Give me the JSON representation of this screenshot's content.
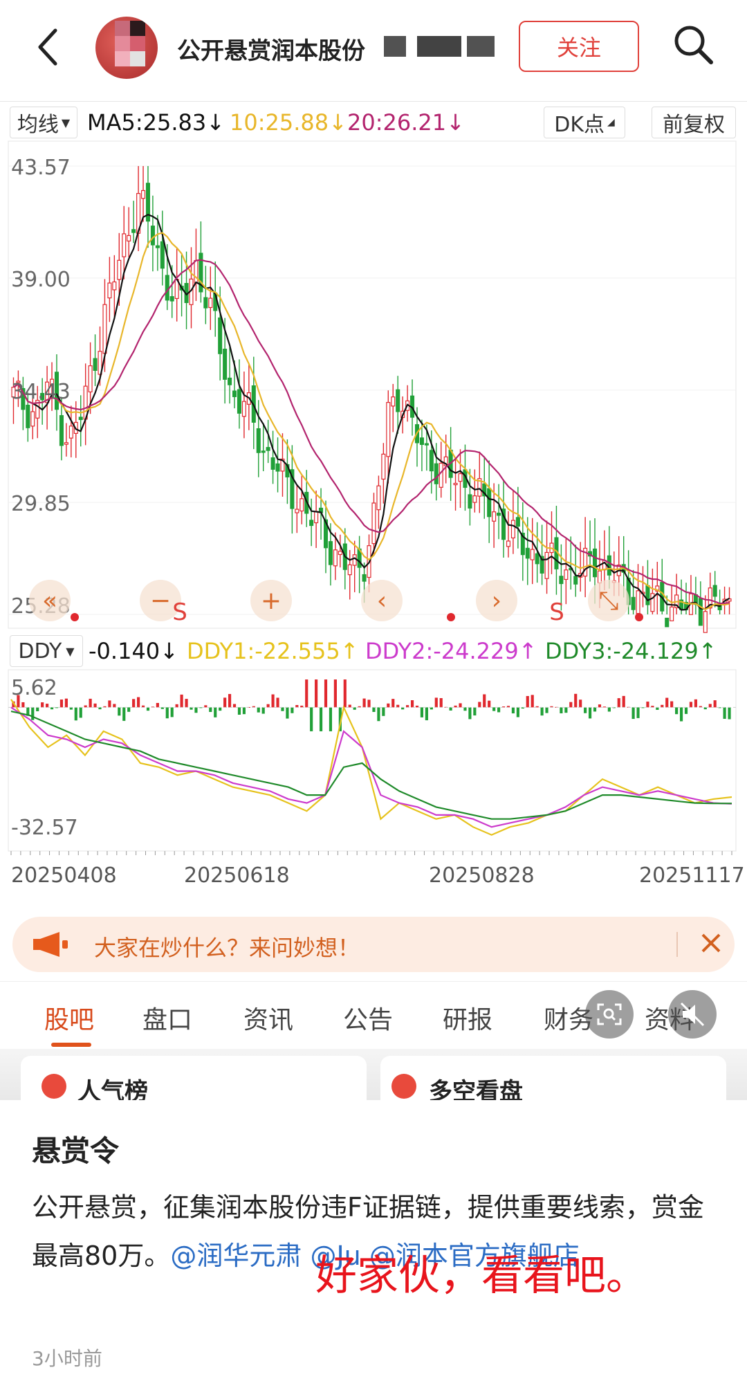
{
  "header": {
    "title": "公开悬赏润本股份",
    "follow_label": "关注"
  },
  "indicators": {
    "ma_type": "均线",
    "ma5": "MA5:25.83↓",
    "ma10": "10:25.88↓",
    "ma20": "20:26.21↓",
    "dk_label": "DK点",
    "adjust_label": "前复权",
    "ddy_label": "DDY",
    "ddy": "-0.140↓",
    "ddy1": "DDY1:-22.555↑",
    "ddy2": "DDY2:-24.229↑",
    "ddy3": "DDY3:-24.129↑"
  },
  "colors": {
    "up": "#e0282e",
    "down": "#21a038",
    "ma5": "#111111",
    "ma10": "#e8b62a",
    "ma20": "#b3246e",
    "ddy1": "#e6c21c",
    "ddy2": "#cc3bcc",
    "ddy3": "#1f8a2a",
    "accent": "#e0403a"
  },
  "chart_data": [
    {
      "type": "candlestick",
      "price_labels": [
        "43.57",
        "39.00",
        "34.43",
        "29.85",
        "25.28"
      ],
      "ylim": [
        25.28,
        43.57
      ],
      "x_labels": [
        "20250408",
        "20250618",
        "20250828",
        "20251117"
      ],
      "markers": [
        "S",
        "S"
      ],
      "series": [
        {
          "name": "MA5",
          "last": 25.83
        },
        {
          "name": "MA10",
          "last": 25.88
        },
        {
          "name": "MA20",
          "last": 26.21
        }
      ],
      "close_trend": [
        34.2,
        33.8,
        33.5,
        34.8,
        33.2,
        32.4,
        33.5,
        35.5,
        37.5,
        39.2,
        40.8,
        42.4,
        41.0,
        39.5,
        38.3,
        38.0,
        39.6,
        38.2,
        36.5,
        34.5,
        34.0,
        33.2,
        32.0,
        31.5,
        30.5,
        30.0,
        29.3,
        28.8,
        28.0,
        27.4,
        27.0,
        27.6,
        30.0,
        33.5,
        34.5,
        33.0,
        32.0,
        31.5,
        31.0,
        30.8,
        30.5,
        30.0,
        29.6,
        29.0,
        28.4,
        28.0,
        27.6,
        27.4,
        27.2,
        27.0,
        26.9,
        27.6,
        27.2,
        26.8,
        26.3,
        26.0,
        25.9,
        25.7,
        25.6,
        25.5,
        25.6,
        25.8,
        25.7,
        25.6
      ]
    },
    {
      "type": "line",
      "ylabels": [
        "5.62",
        "-32.57"
      ],
      "ylim": [
        -32.57,
        5.62
      ],
      "series": [
        {
          "name": "DDY1",
          "last": -22.555
        },
        {
          "name": "DDY2",
          "last": -24.229
        },
        {
          "name": "DDY3",
          "last": -24.129
        }
      ],
      "ddy1_trend": [
        2.0,
        -5.0,
        -10.0,
        -7.0,
        -12.0,
        -6.0,
        -8.0,
        -14.0,
        -15.0,
        -17.0,
        -16.0,
        -18.0,
        -20.0,
        -21.0,
        -22.0,
        -24.0,
        -26.0,
        -22.0,
        0.0,
        -10.0,
        -28.0,
        -24.0,
        -26.0,
        -28.0,
        -27.0,
        -30.0,
        -32.0,
        -30.0,
        -29.0,
        -27.0,
        -26.0,
        -22.0,
        -18.0,
        -20.0,
        -22.0,
        -20.0,
        -22.0,
        -24.0,
        -23.0,
        -22.5
      ],
      "ddy2_trend": [
        0.0,
        -3.0,
        -7.0,
        -8.0,
        -10.0,
        -8.0,
        -9.0,
        -12.0,
        -14.0,
        -16.0,
        -16.0,
        -17.0,
        -19.0,
        -20.0,
        -21.0,
        -23.0,
        -24.0,
        -22.0,
        -6.0,
        -10.0,
        -22.0,
        -24.0,
        -25.0,
        -27.0,
        -27.0,
        -28.0,
        -30.0,
        -29.0,
        -28.0,
        -27.0,
        -25.0,
        -22.0,
        -20.0,
        -21.0,
        -22.0,
        -21.0,
        -22.0,
        -23.0,
        -24.0,
        -24.2
      ],
      "ddy3_trend": [
        -1.0,
        -2.0,
        -4.0,
        -6.0,
        -8.0,
        -9.0,
        -10.0,
        -11.0,
        -13.0,
        -14.0,
        -15.0,
        -16.0,
        -17.0,
        -18.0,
        -19.0,
        -20.0,
        -22.0,
        -22.0,
        -15.0,
        -14.0,
        -18.0,
        -21.0,
        -23.0,
        -25.0,
        -26.0,
        -27.0,
        -28.0,
        -28.0,
        -27.5,
        -27.0,
        -26.0,
        -24.0,
        -22.0,
        -22.0,
        -22.5,
        -23.0,
        -23.5,
        -24.0,
        -24.1,
        -24.1
      ]
    }
  ],
  "ask_banner": {
    "text": "大家在炒什么？来问妙想！"
  },
  "tabs": [
    "股吧",
    "盘口",
    "资讯",
    "公告",
    "研报",
    "财务",
    "资料"
  ],
  "strip": {
    "left": "人气榜",
    "right": "多空看盘"
  },
  "post": {
    "title": "悬赏令",
    "body": "公开悬赏，征集润本股份违F证据链，提供重要线索，赏金最高80万。",
    "mention_1": "@润华元肃",
    "mention_2": "@Ju",
    "mention_3": "@润本官方旗舰店",
    "overlay_text": "好家伙，看看吧。",
    "time": "3小时前"
  }
}
